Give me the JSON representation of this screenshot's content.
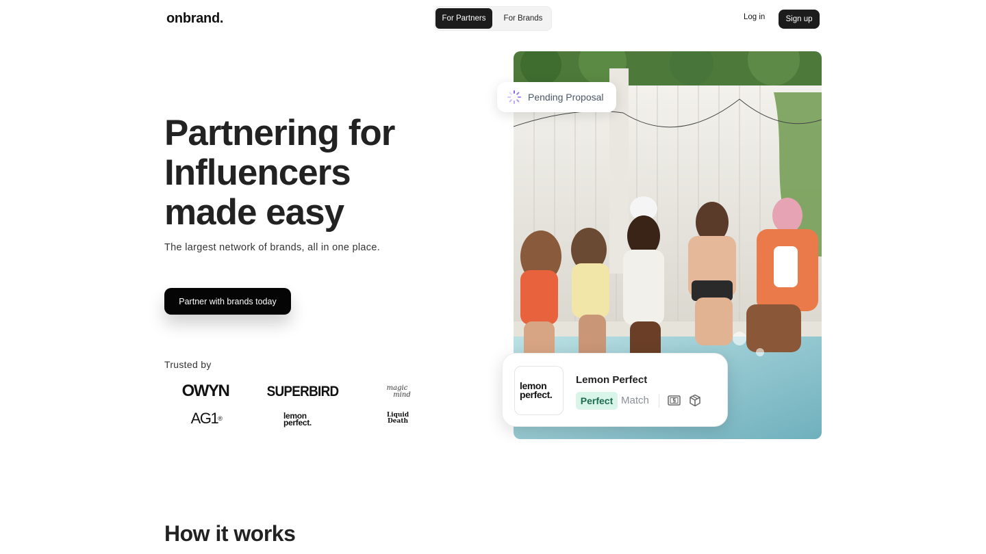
{
  "header": {
    "logo": "onbrand.",
    "toggle": {
      "partners": "For Partners",
      "brands": "For Brands"
    },
    "login": "Log in",
    "signup": "Sign up"
  },
  "hero": {
    "title_lines": [
      "Partnering for",
      "Influencers",
      "made easy"
    ],
    "subtitle": "The largest network of brands, all in one place.",
    "cta": "Partner with brands today",
    "trusted_label": "Trusted by",
    "brands": {
      "owyn": "OWYN",
      "superbird": "SUPERBIRD",
      "magicmind_1": "magic",
      "magicmind_2": "mind",
      "ag1": "AG1",
      "ag1_mark": "®",
      "lemon_1": "lemon",
      "lemon_2": "perfect.",
      "liquid_1": "Liquid",
      "liquid_2": "Death"
    }
  },
  "photo": {
    "pending_label": "Pending Proposal",
    "card": {
      "logo_line1": "lemon",
      "logo_line2": "perfect.",
      "brand_name": "Lemon Perfect",
      "badge": "Perfect",
      "match_label": "Match"
    }
  },
  "section": {
    "how_it_works": "How it works"
  },
  "colors": {
    "primary": "#1c1c1c",
    "badge_bg": "#d9f5ea",
    "badge_text": "#1c6b4e",
    "pending_text": "#4a5666",
    "spinner": "#8b5cf6"
  }
}
